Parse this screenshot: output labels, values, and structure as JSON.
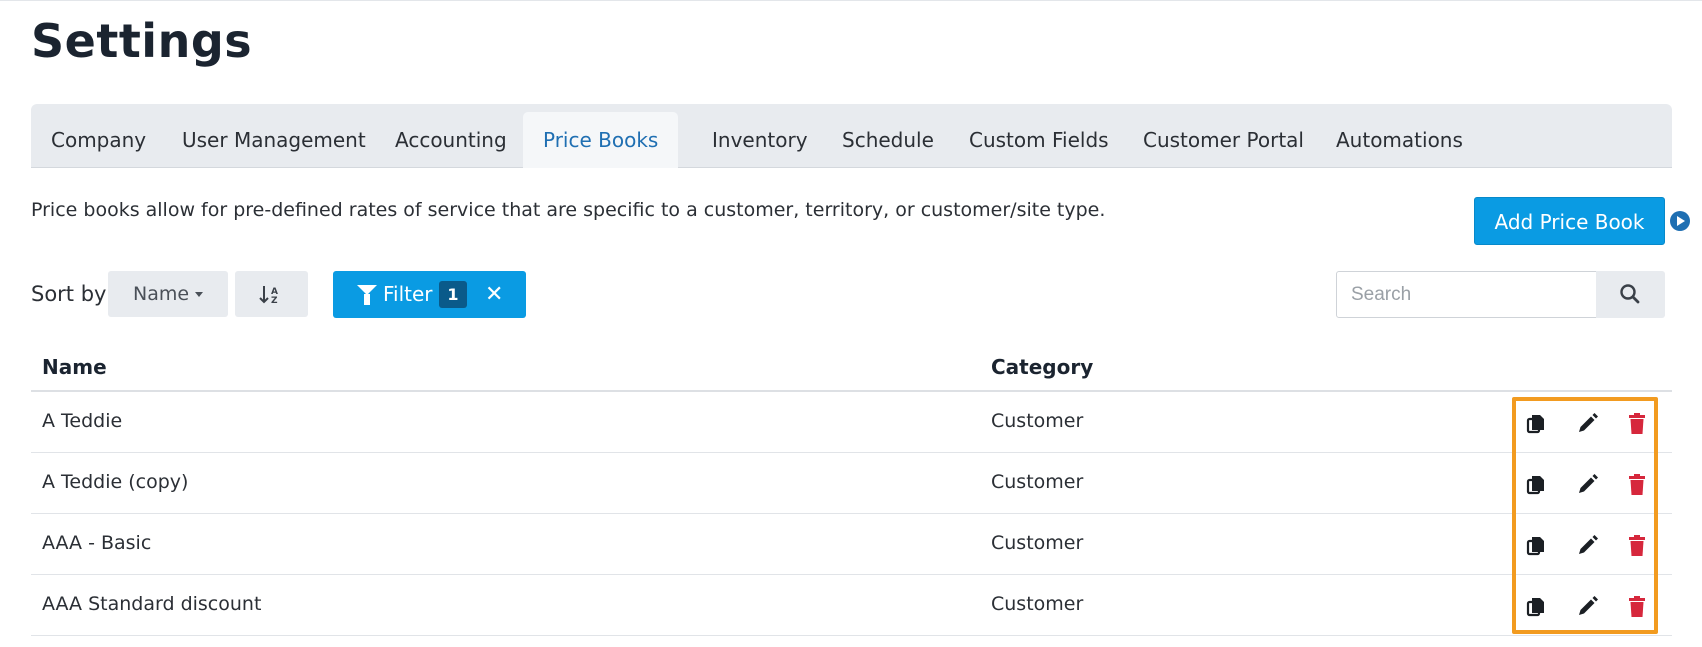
{
  "page": {
    "title": "Settings"
  },
  "tabs": [
    {
      "label": "Company"
    },
    {
      "label": "User Management"
    },
    {
      "label": "Accounting"
    },
    {
      "label": "Price Books",
      "active": true
    },
    {
      "label": "Inventory"
    },
    {
      "label": "Schedule"
    },
    {
      "label": "Custom Fields"
    },
    {
      "label": "Customer Portal"
    },
    {
      "label": "Automations"
    }
  ],
  "description": "Price books allow for pre-defined rates of service that are specific to a customer, territory, or customer/site type.",
  "add_button": {
    "label": "Add Price Book",
    "icon": "play-circle-icon"
  },
  "toolbar": {
    "sort_label": "Sort by",
    "sort_value": "Name",
    "sort_direction_icon": "sort-alpha-down-icon",
    "filter_label": "Filter",
    "filter_count": "1",
    "filter_clear": "✕",
    "search_placeholder": "Search",
    "search_icon": "search-icon"
  },
  "table": {
    "columns": [
      "Name",
      "Category"
    ],
    "rows": [
      {
        "name": "A Teddie",
        "category": "Customer"
      },
      {
        "name": "A Teddie (copy)",
        "category": "Customer"
      },
      {
        "name": "AAA - Basic",
        "category": "Customer"
      },
      {
        "name": "AAA Standard discount",
        "category": "Customer"
      }
    ],
    "row_actions": [
      "copy-icon",
      "pencil-icon",
      "trash-icon"
    ]
  },
  "colors": {
    "primary": "#0a9be3",
    "active_tab_text": "#1f6fb2",
    "delete_icon": "#d6273c",
    "highlight_border": "#f29b20"
  }
}
